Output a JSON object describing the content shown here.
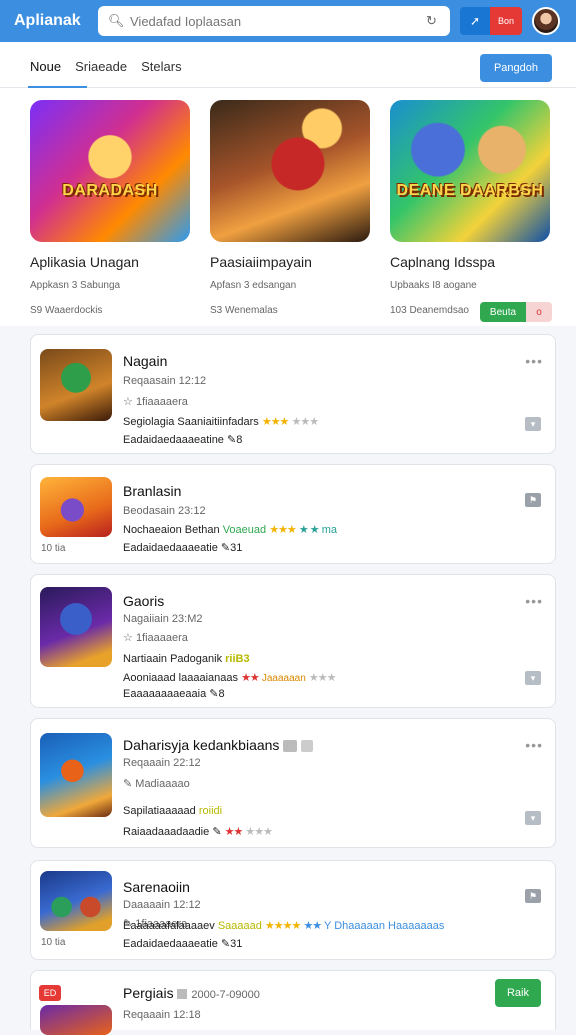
{
  "app": {
    "title": "Aplianak"
  },
  "search": {
    "placeholder": "Viedafad Ioplaasan"
  },
  "header": {
    "red_button_label": "Bon"
  },
  "nav": {
    "tabs": [
      {
        "label": "Noue"
      },
      {
        "label": "Sriaeade"
      },
      {
        "label": "Stelars"
      }
    ],
    "primary_button_label": "Pangdoh"
  },
  "featured": [
    {
      "thumb_text": "DARADASH",
      "title": "Aplikasia Unagan",
      "subtitle": "Appkasn 3 Sabunga",
      "meta": "S9 Waaerdockis"
    },
    {
      "thumb_text": "",
      "title": "Paasiaiimpayain",
      "subtitle": "Apfasn 3 edsangan",
      "meta": "S3 Wenemalas"
    },
    {
      "thumb_text": "DEANE DAARBSH",
      "title": "Caplnang Idsspa",
      "subtitle": "Upbaaks I8 aogane",
      "meta": "103 Deanemdsao",
      "btn_green": "Beuta",
      "btn_light": "o"
    }
  ],
  "list": [
    {
      "name": "Nagain",
      "line1": "Reqaasain 12:12",
      "line2": "1fiaaaaera",
      "row_a_text": "Segiolagia Saaniaitiinfadars",
      "row_b_text": "Eadaidaedaaaeatine",
      "row_b_suffix": "8"
    },
    {
      "name": "Branlasin",
      "line1": "Beodasain 23:12",
      "row_a_text": "Nochaeaion Bethan",
      "row_a_green": "Voaeuad",
      "row_a_tail": "ma",
      "row_b_text": "Eadaidaedaaaeatie",
      "row_b_suffix": "31",
      "badge": "10 tia"
    },
    {
      "name": "Gaoris",
      "line1": "Nagaiiain 23:M2",
      "line2": "1fiaaaaera",
      "row_a_text": "Nartiaain Padoganik",
      "row_a_green": "riiB3",
      "row_b_text": "Aooniaaad laaaaianaas",
      "row_b_red": "Jaaaaaan",
      "row_c_text": "Eaaaaaaaaeaaia",
      "row_c_suffix": "8"
    },
    {
      "name": "Daharisyja kedankbiaans",
      "line1": "Reqaaain 22:12",
      "line2": "Madiaaaao",
      "row_a_text": "Sapilatiaaaaad",
      "row_a_green": "roiidi",
      "row_b_text": "Raiaadaaadaadie"
    },
    {
      "name": "Sarenaoiin",
      "line1": "Daaaaain 12:12",
      "line2": "1fiaaaaera",
      "row_a_text": "Eaaaaaafalaaaaev",
      "row_a_green": "Saaaaad",
      "row_a_tail": "Y Dhaaaaan Haaaaaaas",
      "row_b_text": "Eadaidaedaaaeatie",
      "row_b_suffix": "31",
      "badge": "10 tia"
    },
    {
      "name": "Pergiais",
      "line1": "Reqaaain 12:18",
      "date": "2000-7-09000",
      "add_label": "Raik",
      "tag": "ED"
    }
  ],
  "icons": {
    "search": "search-icon",
    "refresh": "refresh-icon",
    "more": "more-icon"
  },
  "colors": {
    "accent": "#3b8ee0",
    "green": "#2fa84f",
    "red": "#e53935"
  }
}
